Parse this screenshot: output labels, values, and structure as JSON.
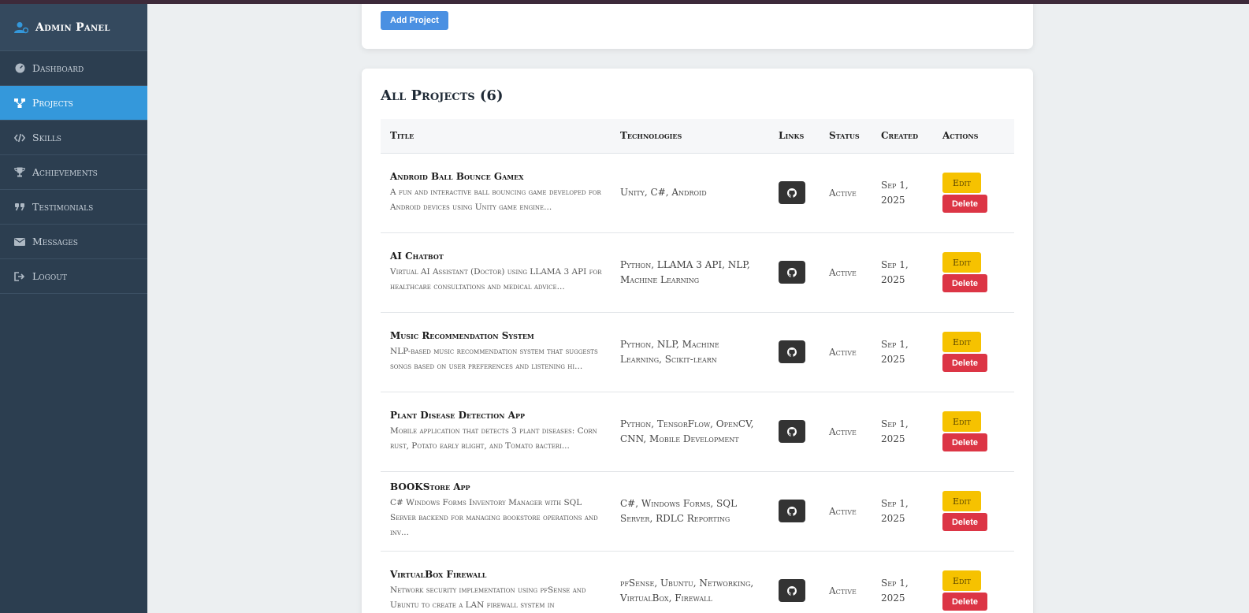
{
  "sidebar": {
    "brand": "Admin Panel",
    "items": [
      {
        "label": "Dashboard",
        "icon": "dashboard-icon"
      },
      {
        "label": "Projects",
        "icon": "projects-icon",
        "active": true
      },
      {
        "label": "Skills",
        "icon": "code-icon"
      },
      {
        "label": "Achievements",
        "icon": "trophy-icon"
      },
      {
        "label": "Testimonials",
        "icon": "quote-icon"
      },
      {
        "label": "Messages",
        "icon": "envelope-icon"
      },
      {
        "label": "Logout",
        "icon": "logout-icon"
      }
    ]
  },
  "top": {
    "add_label": "Add Project"
  },
  "projects": {
    "heading": "All Projects (6)",
    "columns": [
      "Title",
      "Technologies",
      "Links",
      "Status",
      "Created",
      "Actions"
    ],
    "edit_label": "Edit",
    "delete_label": "Delete",
    "rows": [
      {
        "title": "Android Ball Bounce Gamex",
        "desc": "A fun and interactive ball bouncing game developed for Android devices using Unity game engine...",
        "tech": "Unity, C#, Android",
        "status": "Active",
        "created": "Sep 1, 2025"
      },
      {
        "title": "AI Chatbot",
        "desc": "Virtual AI Assistant (Doctor) using LLAMA 3 API for healthcare consultations and medical advice...",
        "tech": "Python, LLAMA 3 API, NLP, Machine Learning",
        "status": "Active",
        "created": "Sep 1, 2025"
      },
      {
        "title": "Music Recommendation System",
        "desc": "NLP-based music recommendation system that suggests songs based on user preferences and listening hi...",
        "tech": "Python, NLP, Machine Learning, Scikit-learn",
        "status": "Active",
        "created": "Sep 1, 2025"
      },
      {
        "title": "Plant Disease Detection App",
        "desc": "Mobile application that detects 3 plant diseases: Corn rust, Potato early blight, and Tomato bacteri...",
        "tech": "Python, TensorFlow, OpenCV, CNN, Mobile Development",
        "status": "Active",
        "created": "Sep 1, 2025"
      },
      {
        "title": "BOOKStore App",
        "desc": "C# Windows Forms Inventory Manager with SQL Server backend for managing bookstore operations and inv...",
        "tech": "C#, Windows Forms, SQL Server, RDLC Reporting",
        "status": "Active",
        "created": "Sep 1, 2025"
      },
      {
        "title": "VirtualBox Firewall",
        "desc": "Network security implementation using pfSense and Ubuntu to create a LAN firewall system in",
        "tech": "pfSense, Ubuntu, Networking, VirtualBox, Firewall",
        "status": "Active",
        "created": "Sep 1, 2025"
      }
    ]
  }
}
